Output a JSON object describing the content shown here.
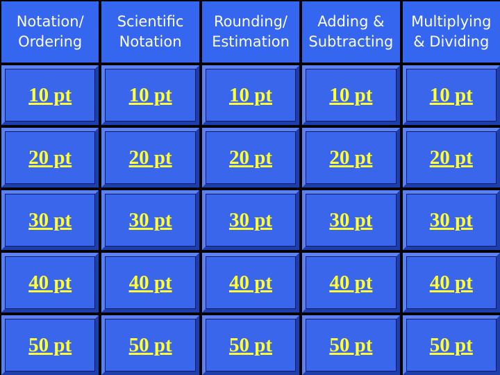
{
  "categories": [
    "Notation/\nOrdering",
    "Scientific\nNotation",
    "Rounding/\nEstimation",
    "Adding &\nSubtracting",
    "Multiplying\n& Dividing"
  ],
  "values": [
    "10 pt",
    "20 pt",
    "30 pt",
    "40 pt",
    "50 pt"
  ],
  "colors": {
    "tile": "#3a66ec",
    "header": "#3466f0",
    "value_text": "#ffff33",
    "header_text": "#ffffff"
  }
}
